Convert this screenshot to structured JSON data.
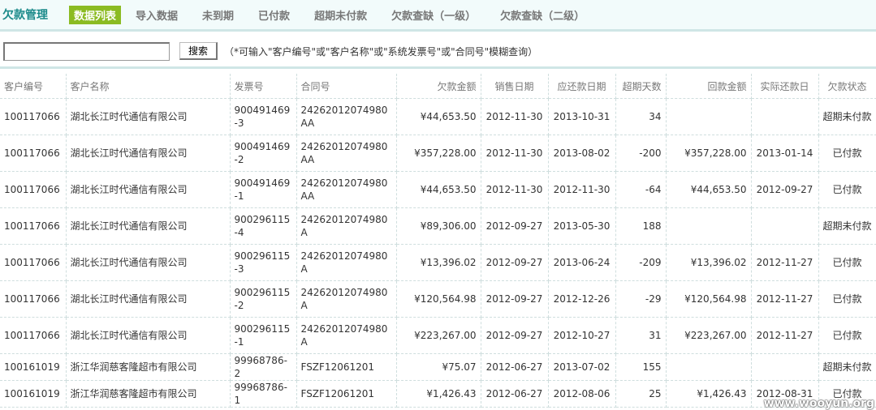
{
  "header": {
    "title": "欠款管理",
    "tabs": [
      "数据列表",
      "导入数据",
      "未到期",
      "已付款",
      "超期未付款",
      "欠款查缺（一级）",
      "欠款查缺（二级）"
    ]
  },
  "search": {
    "value": "",
    "button": "搜索",
    "hint": "（*可输入\"客户编号\"或\"客户名称\"或\"系统发票号\"或\"合同号\"模糊查询）"
  },
  "table": {
    "columns": [
      "客户编号",
      "客户名称",
      "发票号",
      "合同号",
      "欠款金额",
      "销售日期",
      "应还款日期",
      "超期天数",
      "回款金额",
      "实际还款日",
      "欠款状态"
    ],
    "rows": [
      [
        "100117066",
        "湖北长江时代通信有限公司",
        "900491469-3",
        "24262012074980AA",
        "¥44,653.50",
        "2012-11-30",
        "2013-10-31",
        "34",
        "",
        "",
        "超期未付款"
      ],
      [
        "100117066",
        "湖北长江时代通信有限公司",
        "900491469-2",
        "24262012074980AA",
        "¥357,228.00",
        "2012-11-30",
        "2013-08-02",
        "-200",
        "¥357,228.00",
        "2013-01-14",
        "已付款"
      ],
      [
        "100117066",
        "湖北长江时代通信有限公司",
        "900491469-1",
        "24262012074980AA",
        "¥44,653.50",
        "2012-11-30",
        "2012-11-30",
        "-64",
        "¥44,653.50",
        "2012-09-27",
        "已付款"
      ],
      [
        "100117066",
        "湖北长江时代通信有限公司",
        "900296115-4",
        "24262012074980A",
        "¥89,306.00",
        "2012-09-27",
        "2013-05-30",
        "188",
        "",
        "",
        "超期未付款"
      ],
      [
        "100117066",
        "湖北长江时代通信有限公司",
        "900296115-3",
        "24262012074980A",
        "¥13,396.02",
        "2012-09-27",
        "2013-06-24",
        "-209",
        "¥13,396.02",
        "2012-11-27",
        "已付款"
      ],
      [
        "100117066",
        "湖北长江时代通信有限公司",
        "900296115-2",
        "24262012074980A",
        "¥120,564.98",
        "2012-09-27",
        "2012-12-26",
        "-29",
        "¥120,564.98",
        "2012-11-27",
        "已付款"
      ],
      [
        "100117066",
        "湖北长江时代通信有限公司",
        "900296115-1",
        "24262012074980A",
        "¥223,267.00",
        "2012-09-27",
        "2012-10-27",
        "31",
        "¥223,267.00",
        "2012-11-27",
        "已付款"
      ],
      [
        "100161019",
        "浙江华润慈客隆超市有限公司",
        "99968786-2",
        "FSZF12061201",
        "¥75.07",
        "2012-06-27",
        "2013-07-02",
        "155",
        "",
        "",
        "超期未付款"
      ],
      [
        "100161019",
        "浙江华润慈客隆超市有限公司",
        "99968786-1",
        "FSZF12061201",
        "¥1,426.43",
        "2012-06-27",
        "2012-08-06",
        "25",
        "¥1,426.43",
        "2012-08-31",
        "已付款"
      ]
    ]
  },
  "watermark": "www.wooyun.org"
}
